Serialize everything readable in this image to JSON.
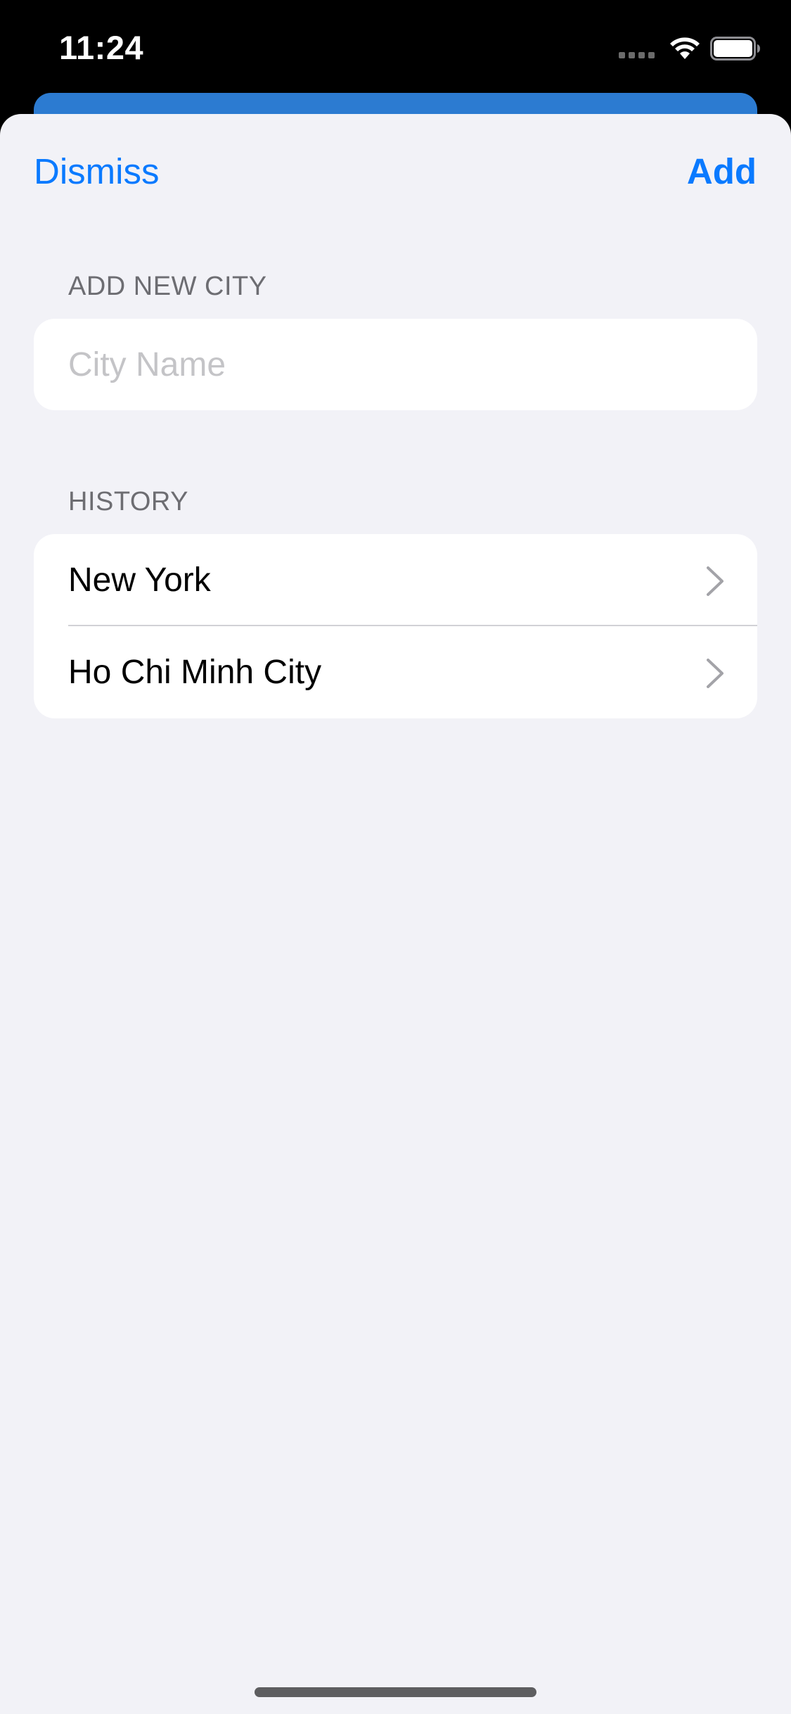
{
  "status_bar": {
    "time": "11:24",
    "wifi_icon": "wifi-icon",
    "battery_icon": "battery-icon",
    "signal_icon": "cellular-signal-icon"
  },
  "nav": {
    "dismiss_label": "Dismiss",
    "add_label": "Add"
  },
  "add_section": {
    "header": "ADD NEW CITY",
    "input_placeholder": "City Name",
    "input_value": ""
  },
  "history_section": {
    "header": "HISTORY",
    "items": [
      {
        "label": "New York",
        "icon": "chevron-right-icon"
      },
      {
        "label": "Ho Chi Minh City",
        "icon": "chevron-right-icon"
      }
    ]
  },
  "colors": {
    "accent": "#0a7aff",
    "background": "#f2f2f7",
    "underlying_sheet": "#2c7bd1"
  }
}
